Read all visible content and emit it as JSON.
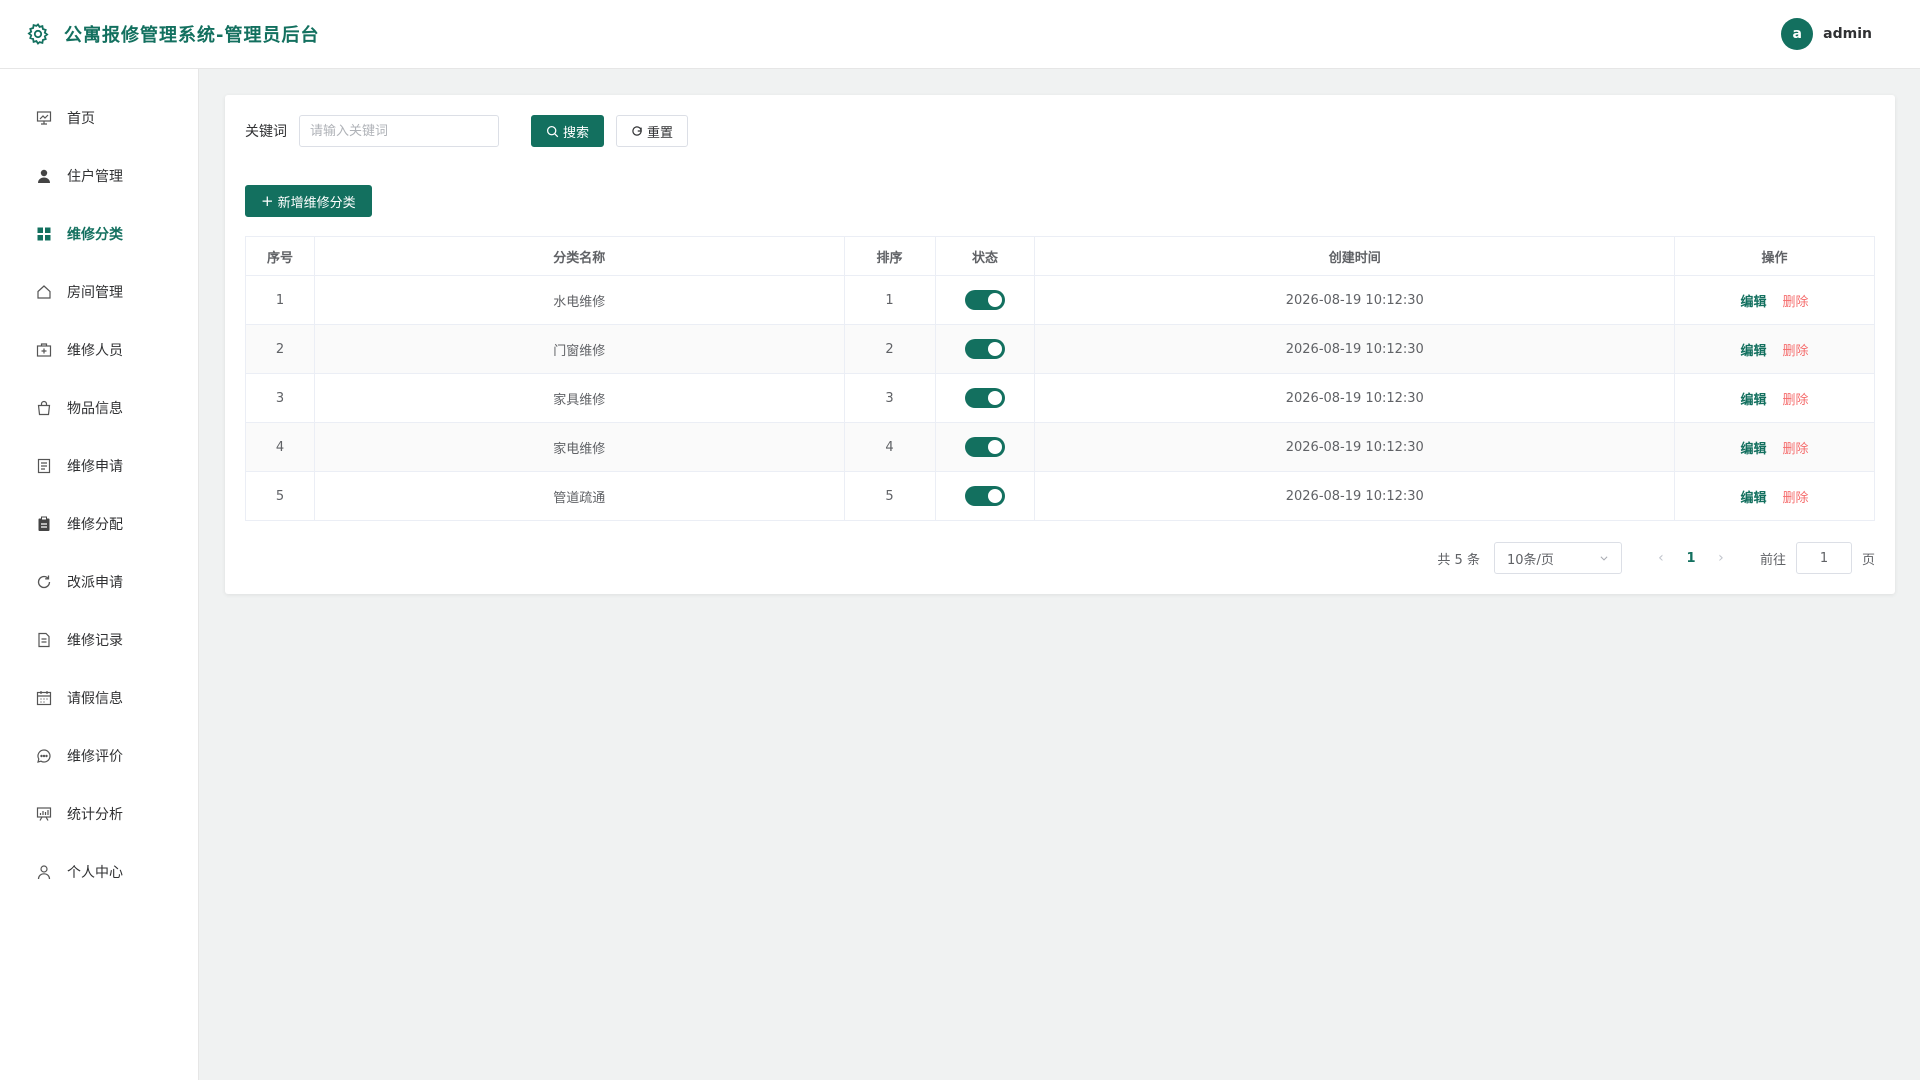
{
  "header": {
    "title": "公寓报修管理系统-管理员后台",
    "avatar_letter": "a",
    "username": "admin",
    "accent_color": "#13705f"
  },
  "sidebar": {
    "items": [
      {
        "label": "首页",
        "icon": "dashboard-chart-icon"
      },
      {
        "label": "住户管理",
        "icon": "user-icon"
      },
      {
        "label": "维修分类",
        "icon": "grid-icon",
        "active": true
      },
      {
        "label": "房间管理",
        "icon": "home-icon"
      },
      {
        "label": "维修人员",
        "icon": "medical-kit-icon"
      },
      {
        "label": "物品信息",
        "icon": "shopping-bag-icon"
      },
      {
        "label": "维修申请",
        "icon": "document-icon"
      },
      {
        "label": "维修分配",
        "icon": "clipboard-icon"
      },
      {
        "label": "改派申请",
        "icon": "refresh-icon"
      },
      {
        "label": "维修记录",
        "icon": "file-list-icon"
      },
      {
        "label": "请假信息",
        "icon": "calendar-icon"
      },
      {
        "label": "维修评价",
        "icon": "chat-bubble-icon"
      },
      {
        "label": "统计分析",
        "icon": "presentation-chart-icon"
      },
      {
        "label": "个人中心",
        "icon": "user-outline-icon"
      }
    ]
  },
  "search": {
    "label": "关键词",
    "placeholder": "请输入关键词",
    "search_button": "搜索",
    "reset_button": "重置"
  },
  "add_button": "新增维修分类",
  "table": {
    "columns": [
      "序号",
      "分类名称",
      "排序",
      "状态",
      "创建时间",
      "操作"
    ],
    "rows": [
      {
        "index": "1",
        "name": "水电维修",
        "sort": "1",
        "status": true,
        "created": "2026-08-19 10:12:30"
      },
      {
        "index": "2",
        "name": "门窗维修",
        "sort": "2",
        "status": true,
        "created": "2026-08-19 10:12:30"
      },
      {
        "index": "3",
        "name": "家具维修",
        "sort": "3",
        "status": true,
        "created": "2026-08-19 10:12:30"
      },
      {
        "index": "4",
        "name": "家电维修",
        "sort": "4",
        "status": true,
        "created": "2026-08-19 10:12:30"
      },
      {
        "index": "5",
        "name": "管道疏通",
        "sort": "5",
        "status": true,
        "created": "2026-08-19 10:12:30"
      }
    ],
    "edit_label": "编辑",
    "delete_label": "删除"
  },
  "pagination": {
    "total_text": "共 5 条",
    "page_size": "10条/页",
    "current_page": "1",
    "goto_label": "前往",
    "goto_value": "1",
    "page_suffix": "页"
  }
}
